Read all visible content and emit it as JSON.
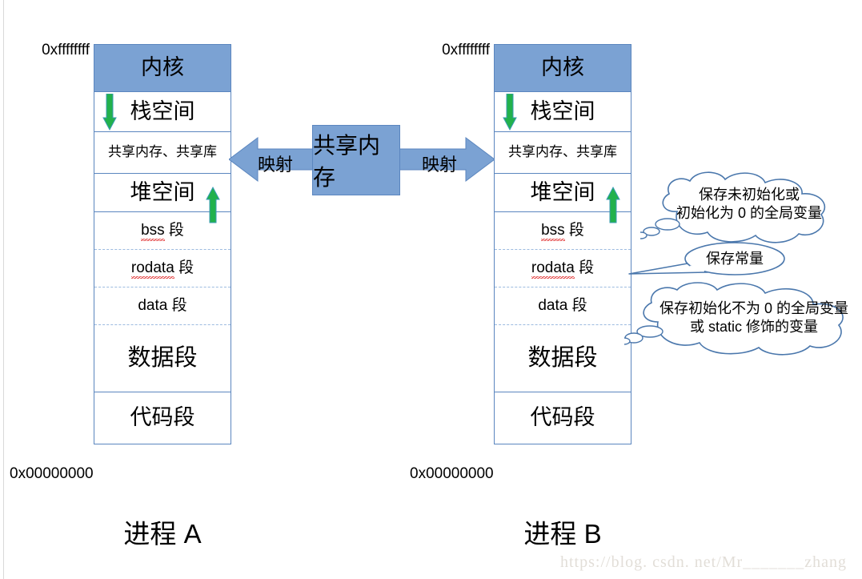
{
  "diagram": {
    "title": "Process virtual memory layout and shared memory mapping",
    "colors": {
      "block_fill": "#7ba2d3",
      "block_border": "#5b86bf",
      "arrow_green": "#22b14c",
      "dashed_divider": "#9dbbe0",
      "callout_stroke": "#4a77ac",
      "watermark": "#e2ded8"
    }
  },
  "process_a": {
    "caption": "进程 A",
    "address_top": "0xffffffff",
    "address_bottom": "0x00000000",
    "segments": {
      "kernel": "内核",
      "stack": "栈空间",
      "shared": "共享内存、共享库",
      "heap": "堆空间",
      "bss": "bss 段",
      "bss_name": "bss",
      "bss_suffix": "段",
      "rodata": "rodata 段",
      "rodata_name": "rodata",
      "rodata_suffix": "段",
      "data": "data 段",
      "data_name": "data",
      "data_suffix": "段",
      "data_segment": "数据段",
      "text_segment": "代码段"
    }
  },
  "process_b": {
    "caption": "进程 B",
    "address_top": "0xffffffff",
    "address_bottom": "0x00000000",
    "segments": {
      "kernel": "内核",
      "stack": "栈空间",
      "shared": "共享内存、共享库",
      "heap": "堆空间",
      "bss": "bss 段",
      "bss_name": "bss",
      "bss_suffix": "段",
      "rodata": "rodata 段",
      "rodata_name": "rodata",
      "rodata_suffix": "段",
      "data": "data 段",
      "data_name": "data",
      "data_suffix": "段",
      "data_segment": "数据段",
      "text_segment": "代码段"
    }
  },
  "shared_memory": {
    "label": "共享内存",
    "map_left_label": "映射",
    "map_right_label": "映射"
  },
  "callouts": {
    "bss": {
      "line1": "保存未初始化或",
      "line2": "初始化为 0 的全局变量"
    },
    "rodata": {
      "line1": "保存常量"
    },
    "data": {
      "line1": "保存初始化不为 0 的全局变量",
      "line2": "或 static 修饰的变量"
    }
  },
  "watermark": {
    "text": "https://blog. csdn. net/Mr_______zhang"
  }
}
